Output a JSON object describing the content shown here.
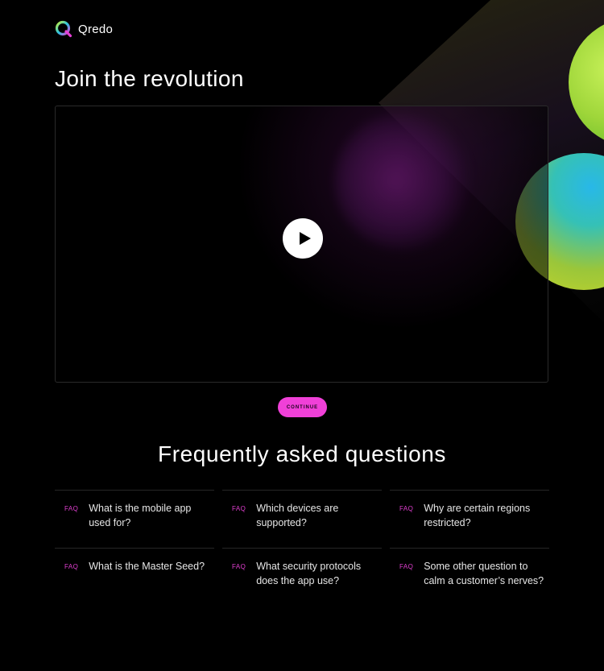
{
  "brand": {
    "name": "Qredo"
  },
  "hero": {
    "title": "Join the revolution"
  },
  "video": {
    "play_icon": "play-icon"
  },
  "cta": {
    "continue_label": "CONTINUE"
  },
  "faq": {
    "title": "Frequently asked questions",
    "tag": "FAQ",
    "items": [
      {
        "question": "What is the mobile app used for?"
      },
      {
        "question": "Which devices are supported?"
      },
      {
        "question": "Why are certain regions restricted?"
      },
      {
        "question": "What is the Master Seed?"
      },
      {
        "question": "What security protocols does the app use?"
      },
      {
        "question": "Some other question to calm a customer’s nerves?"
      }
    ]
  },
  "colors": {
    "background": "#000000",
    "accent_pink": "#f040d8",
    "faq_tag": "#e13fd0",
    "text": "#ffffff"
  }
}
